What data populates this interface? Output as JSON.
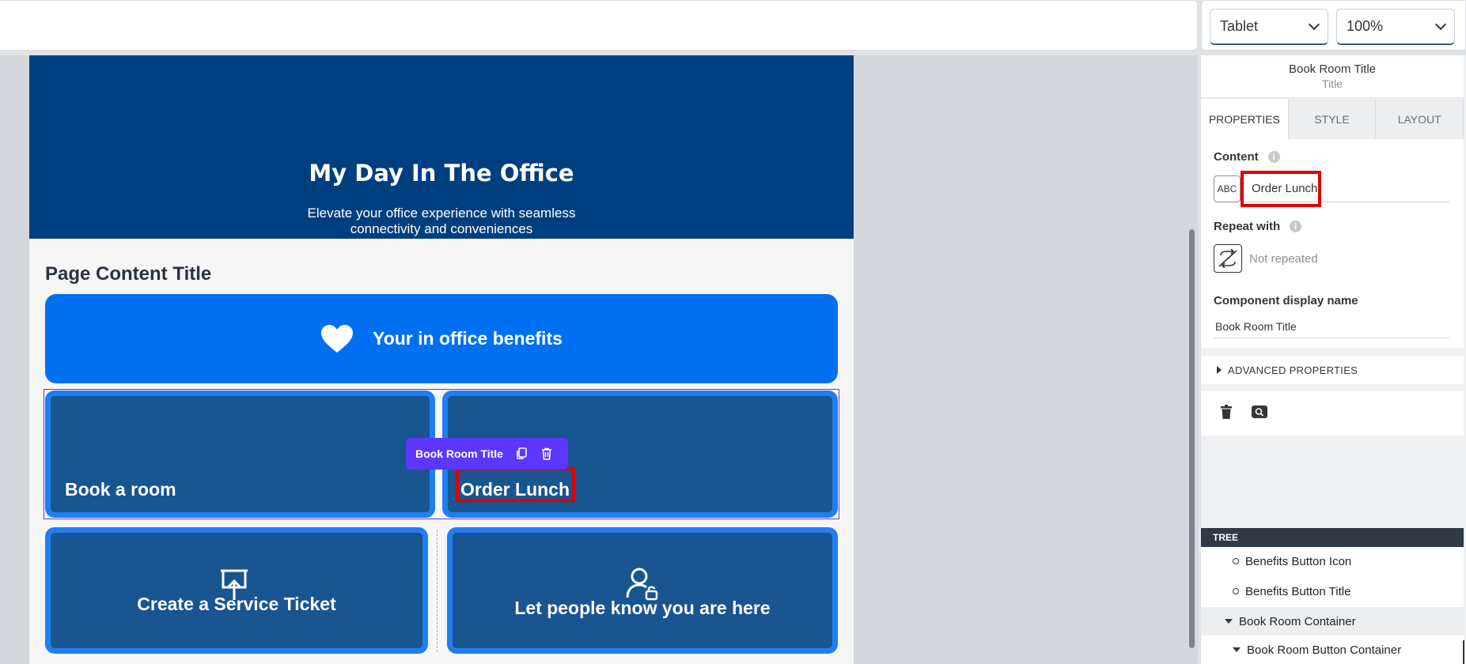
{
  "toolbar": {
    "device_select": "Tablet",
    "zoom_select": "100%"
  },
  "canvas": {
    "hero_title": "My Day In The Office",
    "hero_subtitle": "Elevate your office experience with seamless connectivity and conveniences",
    "page_content_title": "Page Content Title",
    "benefits_button_title": "Your in office benefits",
    "tiles": {
      "book_room": "Book a room",
      "order_lunch": "Order Lunch",
      "service_ticket": "Create a Service Ticket",
      "presence": "Let people know you are here"
    },
    "selection_chip_label": "Book Room Title",
    "colors": {
      "hero_bg": "#003f7f",
      "benefits_bg": "#0070f2",
      "tile_bg": "#185591",
      "selection": "#5d36ff",
      "highlight": "#e00000"
    }
  },
  "panel": {
    "header_title": "Book Room Title",
    "header_type": "Title",
    "tabs": [
      "PROPERTIES",
      "STYLE",
      "LAYOUT"
    ],
    "content_label": "Content",
    "abc_icon": "ABC",
    "content_value": "Order Lunch",
    "repeat_label": "Repeat with",
    "repeat_value": "Not repeated",
    "display_name_label": "Component display name",
    "display_name_value": "Book Room Title",
    "advanced_label": "ADVANCED PROPERTIES",
    "tree_header": "TREE",
    "tree_items": [
      "Benefits Button Icon",
      "Benefits Button Title",
      "Book Room Container",
      "Book Room Button Container"
    ]
  }
}
